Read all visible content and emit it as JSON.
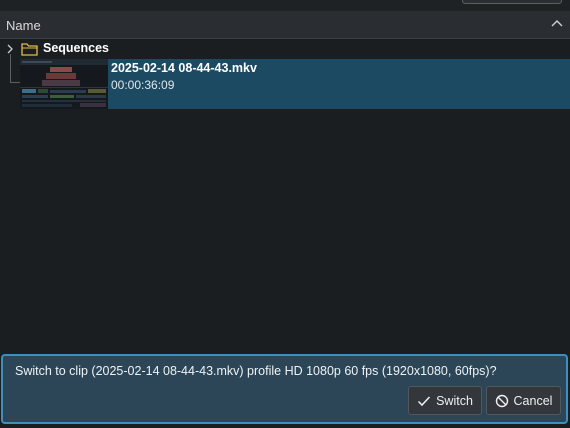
{
  "header": {
    "name_label": "Name"
  },
  "tree": {
    "folder": {
      "label": "Sequences"
    },
    "clip": {
      "name": "2025-02-14 08-44-43.mkv",
      "duration": "00:00:36:09"
    }
  },
  "dialog": {
    "message": "Switch to clip (2025-02-14 08-44-43.mkv) profile HD 1080p 60 fps (1920x1080, 60fps)?",
    "switch_label": "Switch",
    "cancel_label": "Cancel"
  },
  "colors": {
    "selection": "#1d4a63",
    "dialog_bg": "#2c4658",
    "dialog_border": "#3e8fc0",
    "folder_icon": "#e8b84a"
  },
  "icons": {
    "expander": "chevron-right-icon",
    "folder": "folder-icon",
    "sort": "chevron-up-icon",
    "switch": "checkmark-icon",
    "cancel": "cancel-circle-icon"
  }
}
